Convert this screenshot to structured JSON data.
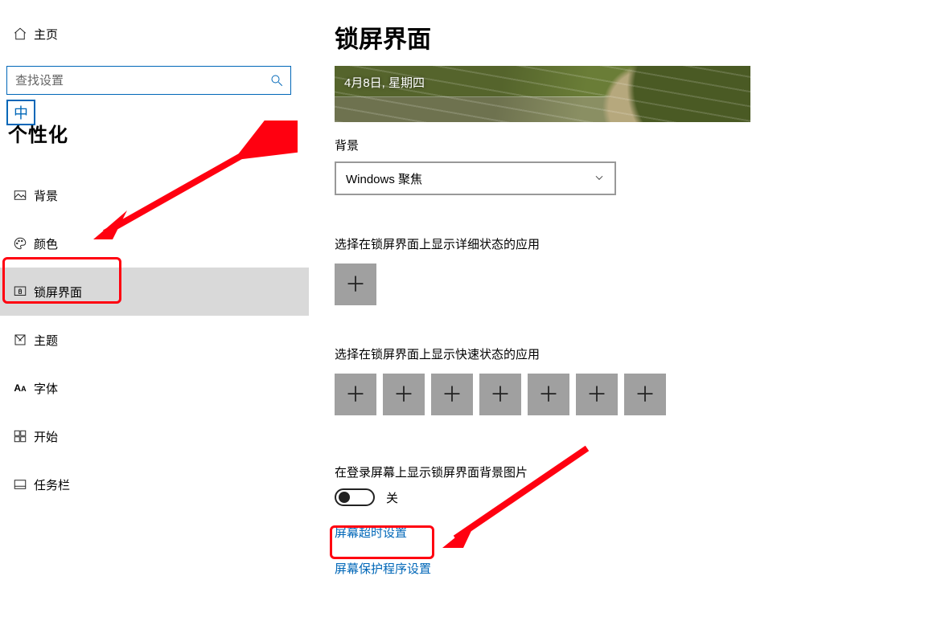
{
  "sidebar": {
    "home": "主页",
    "search_placeholder": "查找设置",
    "ime_badge": "中",
    "category_title": "个性化",
    "items": [
      {
        "label": "背景"
      },
      {
        "label": "颜色"
      },
      {
        "label": "锁屏界面"
      },
      {
        "label": "主题"
      },
      {
        "label": "字体"
      },
      {
        "label": "开始"
      },
      {
        "label": "任务栏"
      }
    ]
  },
  "main": {
    "title": "锁屏界面",
    "preview_date": "4月8日, 星期四",
    "background_label": "背景",
    "background_dropdown_value": "Windows 聚焦",
    "detail_app_label": "选择在锁屏界面上显示详细状态的应用",
    "quick_app_label": "选择在锁屏界面上显示快速状态的应用",
    "show_bg_label": "在登录屏幕上显示锁屏界面背景图片",
    "toggle_text": "关",
    "link_timeout": "屏幕超时设置",
    "link_saver": "屏幕保护程序设置"
  }
}
